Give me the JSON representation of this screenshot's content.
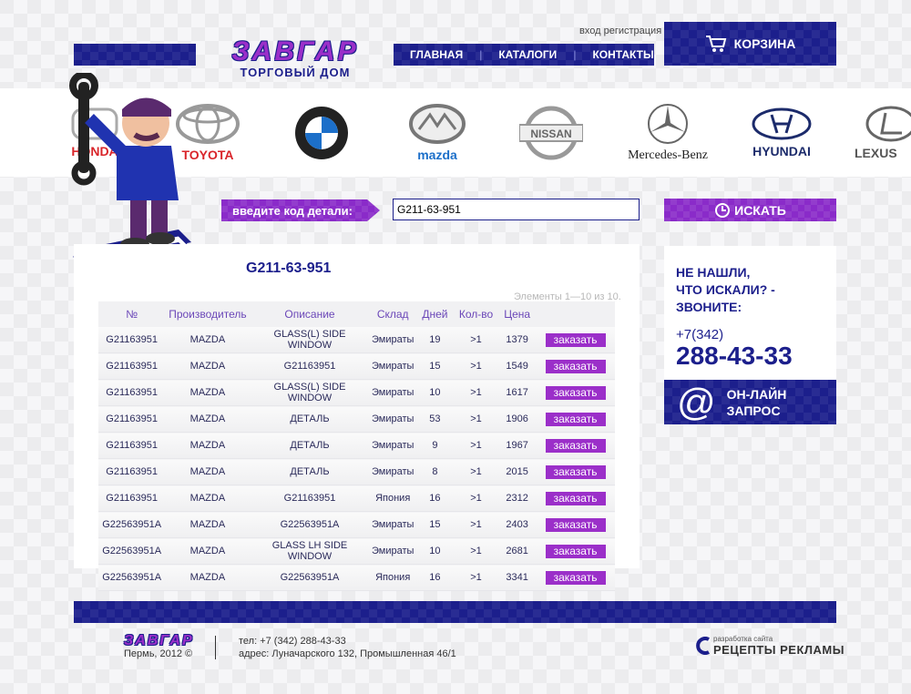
{
  "header": {
    "logo_main": "ЗАВГАР",
    "logo_sub": "ТОРГОВЫЙ ДОМ",
    "login_link": "вход",
    "register_link": "регистрация",
    "nav": [
      "ГЛАВНАЯ",
      "КАТАЛОГИ",
      "КОНТАКТЫ"
    ],
    "cart_label": "КОРЗИНА"
  },
  "brands": [
    {
      "name": "HONDA",
      "color": "#d9252a"
    },
    {
      "name": "TOYOTA",
      "color": "#d9252a"
    },
    {
      "name": "BMW",
      "color": "#1c6fc9"
    },
    {
      "name": "mazda",
      "color": "#1c6fc9"
    },
    {
      "name": "NISSAN",
      "color": "#888888"
    },
    {
      "name": "Mercedes-Benz",
      "color": "#222222"
    },
    {
      "name": "HYUNDAI",
      "color": "#1c2b6b"
    },
    {
      "name": "LEXUS",
      "color": "#555555"
    }
  ],
  "search": {
    "label": "введите код детали:",
    "value": "G211-63-951",
    "button": "ИСКАТЬ"
  },
  "results": {
    "title": "G211-63-951",
    "count_text": "Элементы 1—10 из 10.",
    "columns": [
      "№",
      "Производитель",
      "Описание",
      "Склад",
      "Дней",
      "Кол-во",
      "Цена",
      ""
    ],
    "rows": [
      {
        "code": "G21163951",
        "maker": "MAZDA",
        "desc": "GLASS(L) SIDE WINDOW",
        "stock": "Эмираты",
        "days": "19",
        "qty": ">1",
        "price": "1379",
        "order": "заказать"
      },
      {
        "code": "G21163951",
        "maker": "MAZDA",
        "desc": "G21163951",
        "stock": "Эмираты",
        "days": "15",
        "qty": ">1",
        "price": "1549",
        "order": "заказать"
      },
      {
        "code": "G21163951",
        "maker": "MAZDA",
        "desc": "GLASS(L) SIDE WINDOW",
        "stock": "Эмираты",
        "days": "10",
        "qty": ">1",
        "price": "1617",
        "order": "заказать"
      },
      {
        "code": "G21163951",
        "maker": "MAZDA",
        "desc": "ДЕТАЛЬ",
        "stock": "Эмираты",
        "days": "53",
        "qty": ">1",
        "price": "1906",
        "order": "заказать"
      },
      {
        "code": "G21163951",
        "maker": "MAZDA",
        "desc": "ДЕТАЛЬ",
        "stock": "Эмираты",
        "days": "9",
        "qty": ">1",
        "price": "1967",
        "order": "заказать"
      },
      {
        "code": "G21163951",
        "maker": "MAZDA",
        "desc": "ДЕТАЛЬ",
        "stock": "Эмираты",
        "days": "8",
        "qty": ">1",
        "price": "2015",
        "order": "заказать"
      },
      {
        "code": "G21163951",
        "maker": "MAZDA",
        "desc": "G21163951",
        "stock": "Япония",
        "days": "16",
        "qty": ">1",
        "price": "2312",
        "order": "заказать"
      },
      {
        "code": "G22563951A",
        "maker": "MAZDA",
        "desc": "G22563951A",
        "stock": "Эмираты",
        "days": "15",
        "qty": ">1",
        "price": "2403",
        "order": "заказать"
      },
      {
        "code": "G22563951A",
        "maker": "MAZDA",
        "desc": "GLASS LH SIDE WINDOW",
        "stock": "Эмираты",
        "days": "10",
        "qty": ">1",
        "price": "2681",
        "order": "заказать"
      },
      {
        "code": "G22563951A",
        "maker": "MAZDA",
        "desc": "G22563951A",
        "stock": "Япония",
        "days": "16",
        "qty": ">1",
        "price": "3341",
        "order": "заказать"
      }
    ]
  },
  "sidebar": {
    "not_found_lines": [
      "НЕ НАШЛИ,",
      "ЧТО ИСКАЛИ? -",
      "ЗВОНИТЕ:"
    ],
    "phone_code": "+7(342)",
    "phone_number": "288-43-33",
    "online_lines": [
      "ОН-ЛАЙН",
      "ЗАПРОС"
    ]
  },
  "footer": {
    "logo": "ЗАВГАР",
    "city": "Пермь, 2012 ©",
    "tel": "тел: +7 (342) 288-43-33",
    "address": "адрес: Луначарского 132, Промышленная 46/1",
    "dev_small": "разработка сайта",
    "dev_big": "РЕЦЕПТЫ РЕКЛАМЫ"
  },
  "colors": {
    "navy": "#1c1f8c",
    "purple": "#9b2fc9"
  }
}
